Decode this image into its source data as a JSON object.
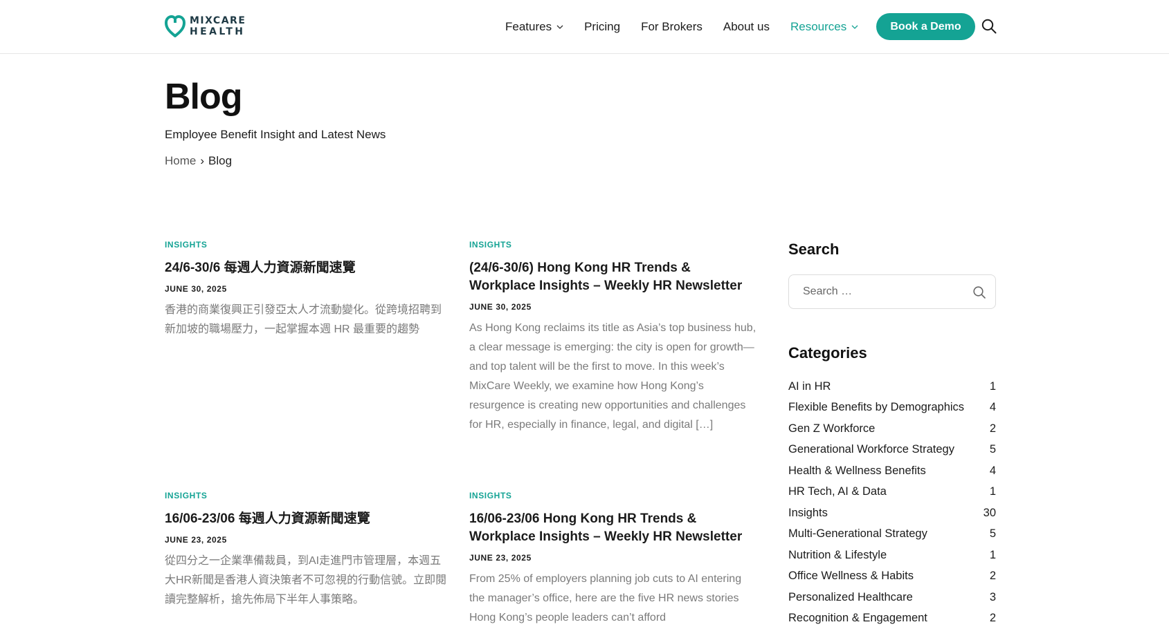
{
  "brand": {
    "line1": "MIXCARE",
    "line2": "HEALTH",
    "accent_color": "#14a394",
    "dark_color": "#1f3a45"
  },
  "nav": {
    "items": [
      {
        "label": "Features",
        "has_dropdown": true
      },
      {
        "label": "Pricing",
        "has_dropdown": false
      },
      {
        "label": "For Brokers",
        "has_dropdown": false
      },
      {
        "label": "About us",
        "has_dropdown": false
      },
      {
        "label": "Resources",
        "has_dropdown": true,
        "active": true
      }
    ],
    "cta_label": "Book a Demo",
    "search_icon": "search-icon"
  },
  "hero": {
    "title": "Blog",
    "subtitle": "Employee Benefit Insight and Latest News",
    "breadcrumb": {
      "home": "Home",
      "separator": "›",
      "current": "Blog"
    }
  },
  "posts": [
    {
      "category": "INSIGHTS",
      "title": "24/6-30/6 每週人力資源新聞速覽",
      "date": "JUNE 30, 2025",
      "excerpt": "香港的商業復興正引發亞太人才流動變化。從跨境招聘到新加坡的職場壓力，一起掌握本週 HR 最重要的趨勢"
    },
    {
      "category": "INSIGHTS",
      "title": "(24/6-30/6) Hong Kong HR Trends & Workplace Insights – Weekly HR Newsletter",
      "date": "JUNE 30, 2025",
      "excerpt": "As Hong Kong reclaims its title as Asia’s top business hub, a clear message is emerging: the city is open for growth—and top talent will be the first to move. In this week’s MixCare Weekly, we examine how Hong Kong’s resurgence is creating new opportunities and challenges for HR, especially in finance, legal, and digital […]"
    },
    {
      "category": "INSIGHTS",
      "title": "16/06-23/06 每週人力資源新聞速覽",
      "date": "JUNE 23, 2025",
      "excerpt": "從四分之一企業準備裁員，到AI走進門市管理層，本週五大HR新聞是香港人資決策者不可忽視的行動信號。立即閱讀完整解析，搶先佈局下半年人事策略。"
    },
    {
      "category": "INSIGHTS",
      "title": "16/06-23/06 Hong Kong HR Trends & Workplace Insights – Weekly HR Newsletter",
      "date": "JUNE 23, 2025",
      "excerpt": "From 25% of employers planning job cuts to AI entering the manager’s office, here are the five HR news stories Hong Kong’s people leaders can’t afford"
    }
  ],
  "sidebar": {
    "search_heading": "Search",
    "search_placeholder": "Search …",
    "categories_heading": "Categories",
    "categories": [
      {
        "name": "AI in HR",
        "count": "1"
      },
      {
        "name": "Flexible Benefits by Demographics",
        "count": "4"
      },
      {
        "name": "Gen Z Workforce",
        "count": "2"
      },
      {
        "name": "Generational Workforce Strategy",
        "count": "5"
      },
      {
        "name": "Health & Wellness Benefits",
        "count": "4"
      },
      {
        "name": "HR Tech, AI & Data",
        "count": "1"
      },
      {
        "name": "Insights",
        "count": "30"
      },
      {
        "name": "Multi-Generational Strategy",
        "count": "5"
      },
      {
        "name": "Nutrition & Lifestyle",
        "count": "1"
      },
      {
        "name": "Office Wellness & Habits",
        "count": "2"
      },
      {
        "name": "Personalized Healthcare",
        "count": "3"
      },
      {
        "name": "Recognition & Engagement",
        "count": "2"
      }
    ]
  }
}
